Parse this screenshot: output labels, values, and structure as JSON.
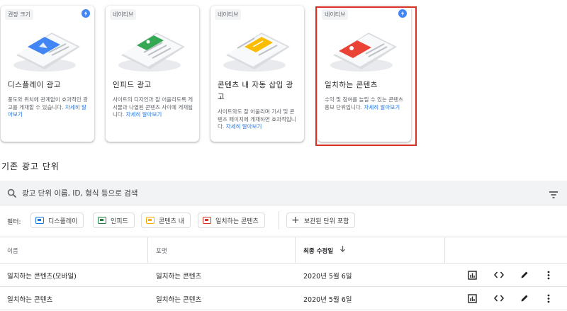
{
  "cards": [
    {
      "tag": "권장 크기",
      "title": "디스플레이 광고",
      "desc": "풍도와 위치에 관계없이 효과적인 광고를 게재할 수 있습니다.",
      "more": "자세히 알아보기",
      "accent": "#4285f4"
    },
    {
      "tag": "네이티브",
      "title": "인피드 광고",
      "desc": "사이트의 디자인과 잘 어울리도록 게시물과 나열된 콘텐츠 사이에 게재됩니다.",
      "more": "자세히 알아보기",
      "accent": "#34a853"
    },
    {
      "tag": "네이티브",
      "title": "콘텐츠 내 자동 삽입 광고",
      "desc": "사이트와도 잘 어울리며 기사 및 콘텐츠 페이지에 게재하면 효과적입니다.",
      "more": "자세히 알아보기",
      "accent": "#fbbc04"
    },
    {
      "tag": "네이티브",
      "title": "일치하는 콘텐츠",
      "desc": "수익 및 참여를 늘릴 수 있는 콘텐츠 홍보 단위입니다.",
      "more": "자세히 알아보기",
      "accent": "#ea4335"
    }
  ],
  "section_title": "기존 광고 단위",
  "search": {
    "placeholder": "광고 단위 이름, ID, 형식 등으로 검색"
  },
  "filters": {
    "label": "필터:",
    "chips": [
      {
        "label": "디스플레이",
        "color": "#1a73e8"
      },
      {
        "label": "인피드",
        "color": "#188038"
      },
      {
        "label": "콘텐츠 내",
        "color": "#f9ab00"
      },
      {
        "label": "일치하는 콘텐츠",
        "color": "#d93025"
      }
    ],
    "archived": "보관된 단위 포함"
  },
  "table": {
    "headers": {
      "name": "이름",
      "format": "포맷",
      "modified": "최종 수정일"
    },
    "sort_icon": "arrow-down-icon",
    "rows": [
      {
        "name": "일치하는 콘텐츠(모바일)",
        "format": "일치하는 콘텐츠",
        "modified": "2020년 5월 6일"
      },
      {
        "name": "일치하는 콘텐츠",
        "format": "일치하는 콘텐츠",
        "modified": "2020년 5월 6일"
      }
    ]
  }
}
